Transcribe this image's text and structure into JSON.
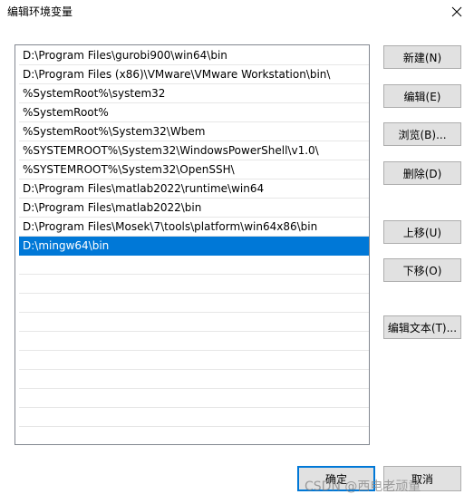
{
  "window": {
    "title": "编辑环境变量",
    "close_icon": "close-icon"
  },
  "path_list": {
    "items": [
      "D:\\Program Files\\gurobi900\\win64\\bin",
      "D:\\Program Files (x86)\\VMware\\VMware Workstation\\bin\\",
      "%SystemRoot%\\system32",
      "%SystemRoot%",
      "%SystemRoot%\\System32\\Wbem",
      "%SYSTEMROOT%\\System32\\WindowsPowerShell\\v1.0\\",
      "%SYSTEMROOT%\\System32\\OpenSSH\\",
      "D:\\Program Files\\matlab2022\\runtime\\win64",
      "D:\\Program Files\\matlab2022\\bin",
      "D:\\Program Files\\Mosek\\7\\tools\\platform\\win64x86\\bin",
      "D:\\mingw64\\bin"
    ],
    "selected_index": 10
  },
  "buttons": {
    "new": "新建(N)",
    "edit": "编辑(E)",
    "browse": "浏览(B)...",
    "delete": "删除(D)",
    "move_up": "上移(U)",
    "move_down": "下移(O)",
    "edit_text": "编辑文本(T)...",
    "ok": "确定",
    "cancel": "取消"
  },
  "watermark": "CSDN @西电老顽童",
  "colors": {
    "selection": "#0078d7",
    "button_face": "#e1e1e1",
    "button_border": "#adadad"
  }
}
